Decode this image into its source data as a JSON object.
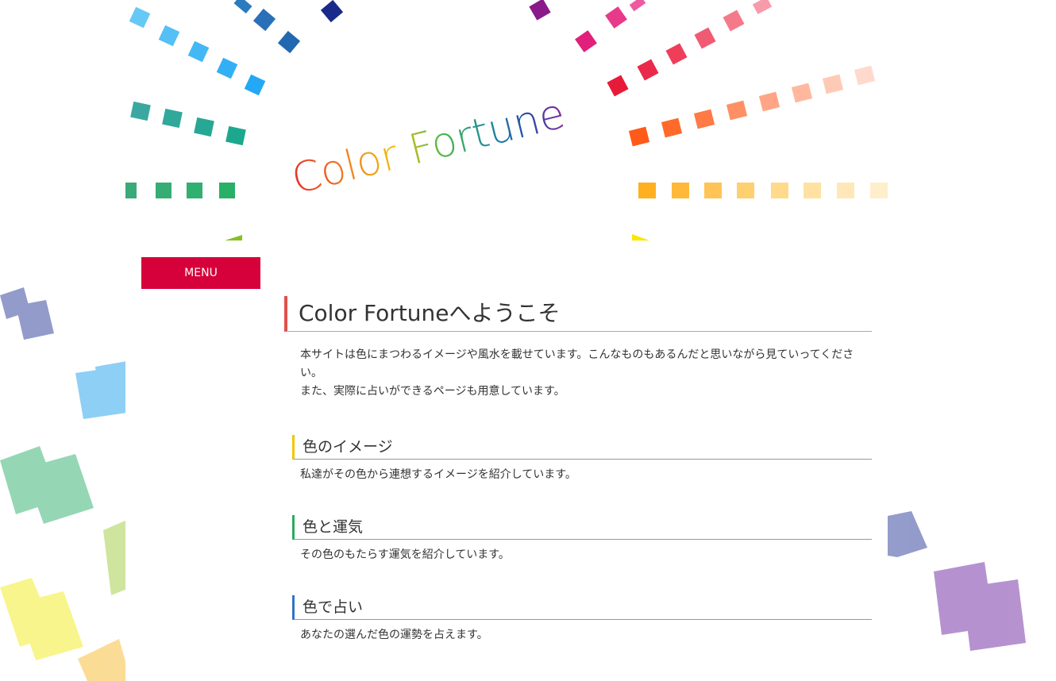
{
  "header": {
    "logo_text": "Color Fortune",
    "menu_label": "MENU"
  },
  "main": {
    "title": "Color Fortuneへようこそ",
    "intro_lines": [
      "本サイトは色にまつわるイメージや風水を載せています。こんなものもあるんだと思いながら見ていってください。",
      "また、実際に占いができるページも用意しています。"
    ],
    "sections": [
      {
        "heading": "色のイメージ",
        "text": "私達がその色から連想するイメージを紹介しています。",
        "accent": "#f0c800"
      },
      {
        "heading": "色と運気",
        "text": "その色のもたらす運気を紹介しています。",
        "accent": "#2ea860"
      },
      {
        "heading": "色で占い",
        "text": "あなたの選んだ色の運勢を占えます。",
        "accent": "#2e74c8"
      }
    ]
  },
  "colors": {
    "menu_bg": "#d6003a",
    "title_accent": "#e0504c"
  }
}
